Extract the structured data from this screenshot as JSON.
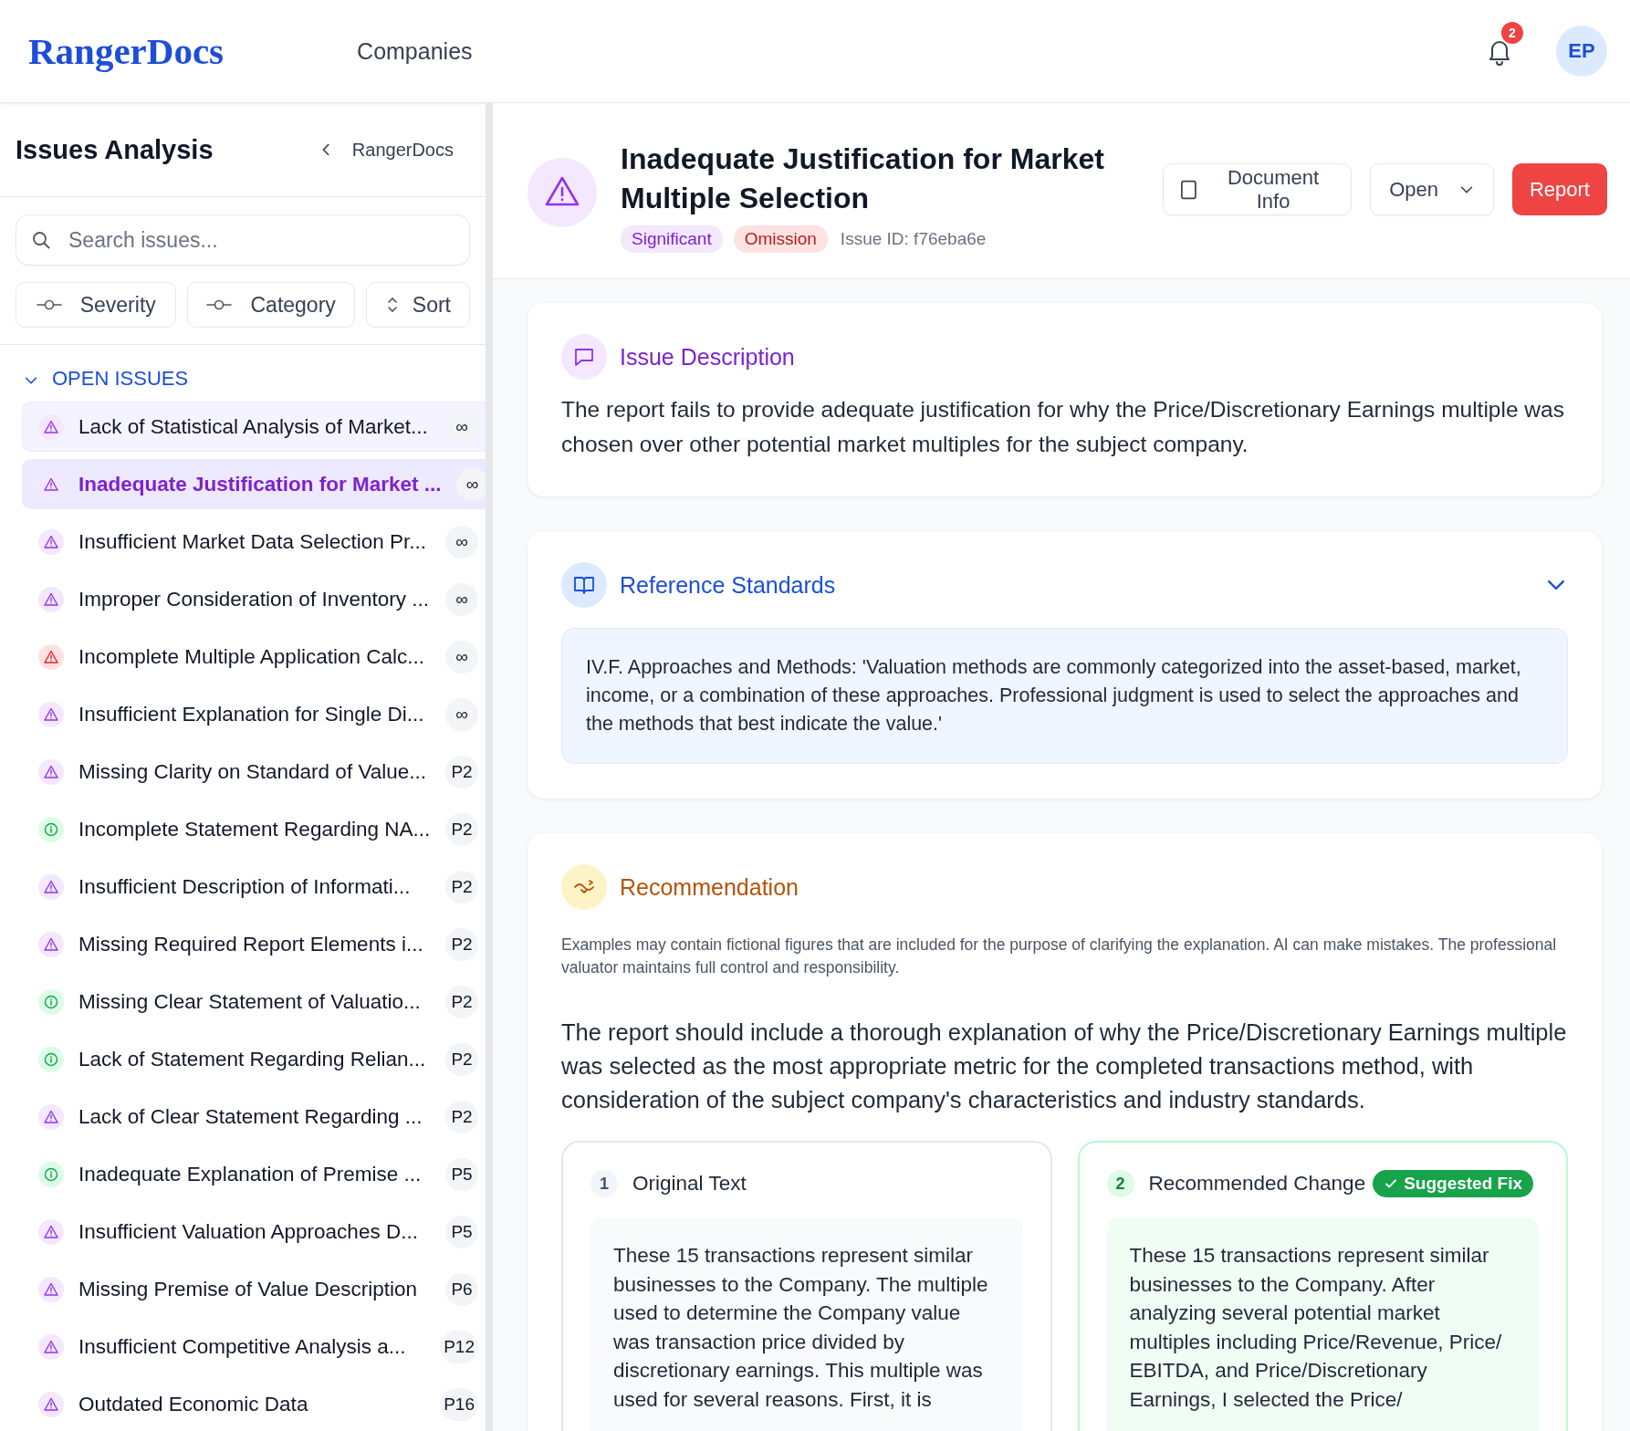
{
  "header": {
    "logo": "RangerDocs",
    "nav": "Companies",
    "notification_count": "2",
    "avatar": "EP"
  },
  "sidebar": {
    "title": "Issues Analysis",
    "back_link": "RangerDocs",
    "search": {
      "placeholder": "Search issues..."
    },
    "filters": [
      {
        "kind": "filter",
        "label": "Severity"
      },
      {
        "kind": "filter",
        "label": "Category"
      },
      {
        "kind": "sort",
        "label": "Sort"
      }
    ],
    "section": {
      "label": "OPEN ISSUES",
      "expanded": true
    },
    "issues": [
      {
        "kind": "warning",
        "title": "Lack of Statistical Analysis of Market...",
        "page": "∞",
        "selected": false,
        "hovered": true
      },
      {
        "kind": "warning",
        "title": "Inadequate Justification for Market ...",
        "page": "∞",
        "selected": true,
        "hovered": false
      },
      {
        "kind": "warning",
        "title": "Insufficient Market Data Selection Pr...",
        "page": "∞",
        "selected": false,
        "hovered": false
      },
      {
        "kind": "warning",
        "title": "Improper Consideration of Inventory ...",
        "page": "∞",
        "selected": false,
        "hovered": false
      },
      {
        "kind": "critical",
        "title": "Incomplete Multiple Application Calc...",
        "page": "∞",
        "selected": false,
        "hovered": false
      },
      {
        "kind": "warning",
        "title": "Insufficient Explanation for Single Di...",
        "page": "∞",
        "selected": false,
        "hovered": false
      },
      {
        "kind": "warning",
        "title": "Missing Clarity on Standard of Value...",
        "page": "P2",
        "selected": false,
        "hovered": false
      },
      {
        "kind": "info",
        "title": "Incomplete Statement Regarding NA...",
        "page": "P2",
        "selected": false,
        "hovered": false
      },
      {
        "kind": "warning",
        "title": "Insufficient Description of Informati...",
        "page": "P2",
        "selected": false,
        "hovered": false
      },
      {
        "kind": "warning",
        "title": "Missing Required Report Elements i...",
        "page": "P2",
        "selected": false,
        "hovered": false
      },
      {
        "kind": "info",
        "title": "Missing Clear Statement of Valuatio...",
        "page": "P2",
        "selected": false,
        "hovered": false
      },
      {
        "kind": "info",
        "title": "Lack of Statement Regarding Relian...",
        "page": "P2",
        "selected": false,
        "hovered": false
      },
      {
        "kind": "warning",
        "title": "Lack of Clear Statement Regarding ...",
        "page": "P2",
        "selected": false,
        "hovered": false
      },
      {
        "kind": "info",
        "title": "Inadequate Explanation of Premise ...",
        "page": "P5",
        "selected": false,
        "hovered": false
      },
      {
        "kind": "warning",
        "title": "Insufficient Valuation Approaches D...",
        "page": "P5",
        "selected": false,
        "hovered": false
      },
      {
        "kind": "warning",
        "title": "Missing Premise of Value Description",
        "page": "P6",
        "selected": false,
        "hovered": false
      },
      {
        "kind": "warning",
        "title": "Insufficient Competitive Analysis a...",
        "page": "P12",
        "selected": false,
        "hovered": false
      },
      {
        "kind": "warning",
        "title": "Outdated Economic Data",
        "page": "P16",
        "selected": false,
        "hovered": false
      }
    ]
  },
  "issue": {
    "title": "Inadequate Justification for Market Multiple Selection",
    "severity": "Significant",
    "category": "Omission",
    "issue_id": "Issue ID: f76eba6e",
    "actions": [
      {
        "kind": "outline",
        "label": "Document Info"
      },
      {
        "kind": "dropdown",
        "label": "Open"
      },
      {
        "kind": "primary",
        "label": "Report"
      }
    ]
  },
  "description": {
    "title": "Issue Description",
    "text": "The report fails to provide adequate justification for why the Price/Discretionary Earnings multiple was chosen over other potential market multiples for the subject company."
  },
  "reference": {
    "title": "Reference Standards",
    "expanded": true,
    "text": "IV.F. Approaches and Methods: 'Valuation methods are commonly categorized into the asset-based, market, income, or a combination of these approaches. Professional judgment is used to select the approaches and the methods that best indicate the value.'"
  },
  "recommendation": {
    "title": "Recommendation",
    "disclaimer": "Examples may contain fictional figures that are included for the purpose of clarifying the explanation. AI can make mistakes. The professional valuator maintains full control and responsibility.",
    "text": "The report should include a thorough explanation of why the Price/Discretionary Earnings multiple was selected as the most appropriate metric for the completed transactions method, with consideration of the subject company's characteristics and industry standards.",
    "panels": [
      {
        "kind": "original",
        "number": "1",
        "title": "Original Text",
        "text": "These 15 transactions represent similar businesses to the Company. The multiple used to determine the Company value was transaction price divided by discretionary earnings. This multiple was used for several reasons. First, it is"
      },
      {
        "kind": "suggested",
        "number": "2",
        "title": "Recommended Change",
        "badge": "Suggested Fix",
        "text": "These 15 transactions represent similar businesses to the Company. After analyzing several potential market multiples including Price/Revenue, Price/ EBITDA, and Price/Discretionary Earnings, I selected the Price/"
      }
    ]
  }
}
